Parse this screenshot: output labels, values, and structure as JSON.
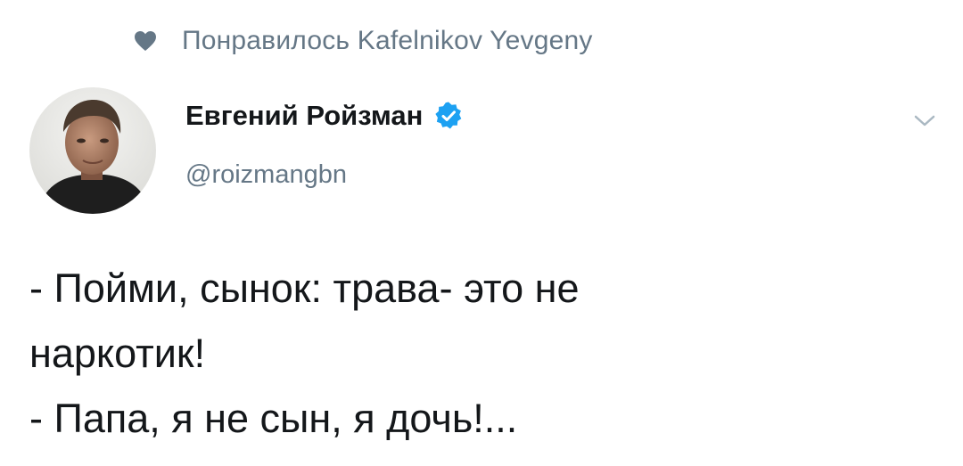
{
  "liked_banner": {
    "icon": "heart-icon",
    "text": "Понравилось Kafelnikov Yevgeny"
  },
  "author": {
    "avatar": "user-avatar",
    "name": "Евгений Ройзман",
    "verified_icon": "verified-badge-icon",
    "handle": "@roizmangbn"
  },
  "menu": {
    "icon": "chevron-down-icon"
  },
  "tweet": {
    "lines": [
      "- Пойми, сынок: трава- это не",
      "наркотик!",
      "- Папа, я не сын, я дочь!..."
    ]
  },
  "colors": {
    "muted_text": "#657786",
    "main_text": "#14171a",
    "verified_blue": "#1da1f2",
    "heart": "#657786"
  }
}
